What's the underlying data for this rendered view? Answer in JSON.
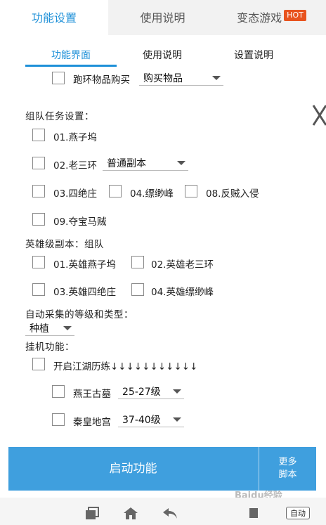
{
  "top_tabs": [
    {
      "label": "功能设置"
    },
    {
      "label": "使用说明"
    },
    {
      "label": "变态游戏",
      "badge": "HOT"
    }
  ],
  "sub_tabs": [
    {
      "label": "功能界面"
    },
    {
      "label": "使用说明"
    },
    {
      "label": "设置说明"
    }
  ],
  "loop_buy": {
    "label": "跑环物品购买",
    "select": "购买物品"
  },
  "team_section": {
    "title": "组队任务设置：",
    "items": [
      {
        "label": "01.燕子坞"
      },
      {
        "label": "02.老三环"
      },
      {
        "label": "03.四绝庄"
      },
      {
        "label": "04.缥缈峰"
      },
      {
        "label": "08.反贼入侵"
      },
      {
        "label": "09.夺宝马贼"
      }
    ],
    "mode_select": "普通副本"
  },
  "hero_section": {
    "title": "英雄级副本：组队",
    "items": [
      {
        "label": "01.英雄燕子坞"
      },
      {
        "label": "02.英雄老三环"
      },
      {
        "label": "03.英雄四绝庄"
      },
      {
        "label": "04.英雄缥缈峰"
      }
    ]
  },
  "gather_section": {
    "title": "自动采集的等级和类型：",
    "select": "种植"
  },
  "idle_section": {
    "title": "挂机功能：",
    "jianghu": "开启江湖历练↓↓↓↓↓↓↓↓↓↓↓",
    "items": [
      {
        "label": "燕王古墓",
        "select": "25-27级"
      },
      {
        "label": "秦皇地宫",
        "select": "37-40级"
      }
    ]
  },
  "footer": {
    "start_label": "启动功能",
    "more_line1": "更多",
    "more_line2": "脚本"
  },
  "navbar": {
    "auto_label": "自动"
  },
  "watermark": "Baidu经验",
  "colors": {
    "accent": "#1e90d8",
    "button": "#3f9fde",
    "hot": "#e8531e"
  }
}
